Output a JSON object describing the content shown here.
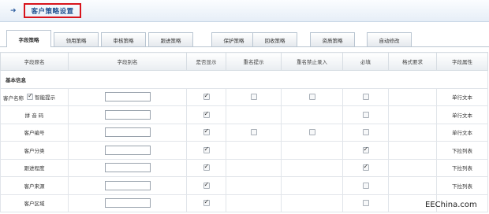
{
  "header": {
    "title": "客户策略设置"
  },
  "tabs": [
    {
      "label": "字段策略",
      "active": true
    },
    {
      "label": "领用策略",
      "active": false
    },
    {
      "label": "审核策略",
      "active": false
    },
    {
      "label": "跟进策略",
      "active": false
    },
    {
      "label": "保护策略",
      "active": false
    },
    {
      "label": "回收策略",
      "active": false
    },
    {
      "label": "资质策略",
      "active": false
    },
    {
      "label": "自动修改",
      "active": false
    }
  ],
  "table": {
    "headers": [
      "字段原名",
      "字段别名",
      "是否显示",
      "重名提示",
      "重名禁止录入",
      "必填",
      "格式要求",
      "字段属性"
    ],
    "section_label": "基本信息",
    "smart_hint_label": "智能提示",
    "rows": [
      {
        "name": "客户名称",
        "alias": "",
        "show": true,
        "dup_hint": false,
        "dup_block": false,
        "required": false,
        "attr": "单行文本"
      },
      {
        "name": "拼 音 码",
        "alias": "",
        "show": true,
        "dup_hint": null,
        "dup_block": null,
        "required": false,
        "attr": "单行文本"
      },
      {
        "name": "客户编号",
        "alias": "",
        "show": true,
        "dup_hint": false,
        "dup_block": false,
        "required": false,
        "attr": "单行文本"
      },
      {
        "name": "客户分类",
        "alias": "",
        "show": true,
        "dup_hint": null,
        "dup_block": null,
        "required": true,
        "attr": "下拉列表"
      },
      {
        "name": "跟进程度",
        "alias": "",
        "show": true,
        "dup_hint": null,
        "dup_block": null,
        "required": true,
        "attr": "下拉列表"
      },
      {
        "name": "客户来源",
        "alias": "",
        "show": true,
        "dup_hint": null,
        "dup_block": null,
        "required": false,
        "attr": "下拉列表"
      },
      {
        "name": "客户区域",
        "alias": "",
        "show": true,
        "dup_hint": null,
        "dup_block": null,
        "required": false,
        "attr": ""
      }
    ]
  },
  "watermark": "EEChina.com"
}
